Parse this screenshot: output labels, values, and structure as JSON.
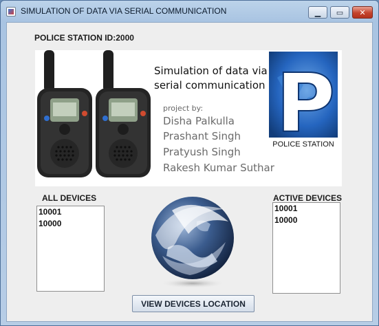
{
  "window": {
    "title": "SIMULATION OF DATA VIA SERIAL COMMUNICATION",
    "controls": {
      "minimize": "▁",
      "maximize": "▭",
      "close": "✕"
    }
  },
  "header": {
    "station_id": "POLICE STATION ID:2000"
  },
  "banner": {
    "title_line1": "Simulation of data via",
    "title_line2": "serial communication",
    "project_by": "project by:",
    "members": [
      "Disha Palkulla",
      "Prashant Singh",
      "Pratyush Singh",
      "Rakesh Kumar Suthar"
    ],
    "logo_letter": "P",
    "logo_caption": "POLICE STATION"
  },
  "all_devices": {
    "label": "ALL DEVICES",
    "items": [
      "10001",
      "10000"
    ]
  },
  "active_devices": {
    "label": "ACTIVE DEVICES",
    "items": [
      "10001",
      "10000"
    ]
  },
  "actions": {
    "view_location": "VIEW DEVICES LOCATION"
  },
  "colors": {
    "logo_blue": "#1c5db8",
    "titlebar": "#b7cde6",
    "close_red": "#c4432c"
  }
}
